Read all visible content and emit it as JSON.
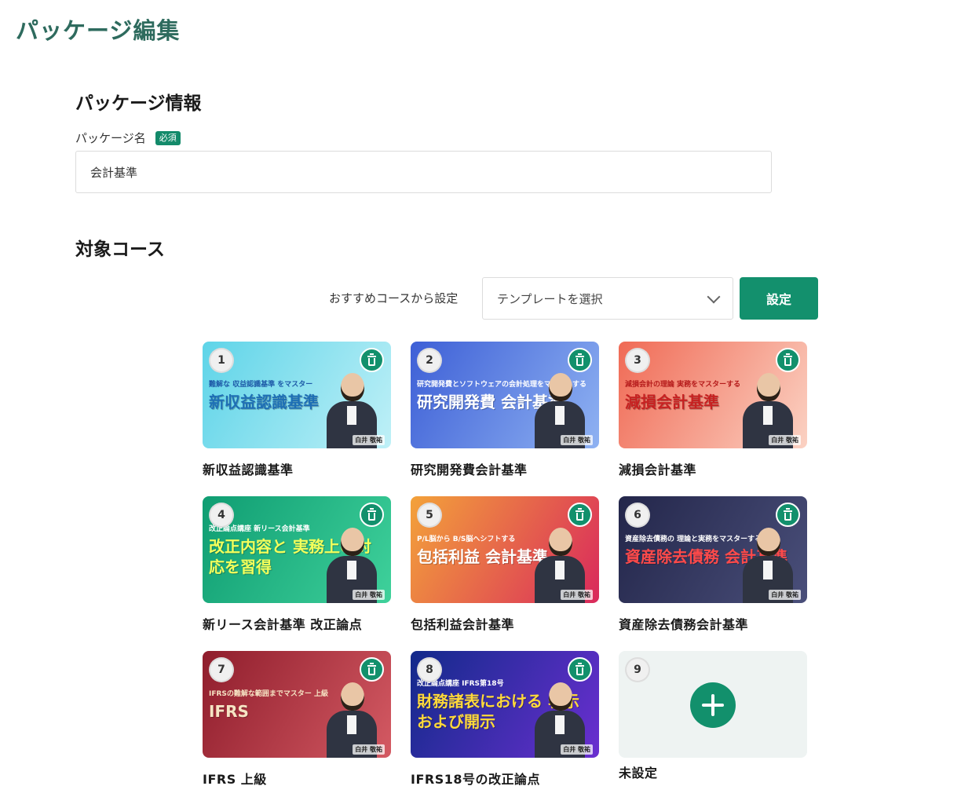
{
  "page": {
    "title": "パッケージ編集"
  },
  "package_info": {
    "section_title": "パッケージ情報",
    "name_label": "パッケージ名",
    "required_badge": "必須",
    "name_value": "会計基準"
  },
  "target_courses": {
    "section_title": "対象コース",
    "template_label": "おすすめコースから設定",
    "template_select": {
      "selected": "テンプレートを選択",
      "icon": "chevron-down-icon"
    },
    "set_button": "設定",
    "courses": [
      {
        "number": "1",
        "title": "新収益認識基準",
        "banner_headline": "新収益認識基準",
        "banner_tag": "難解な 収益認識基準 をマスター",
        "caption": "白井 敬祐",
        "bg_from": "#5ed4e8",
        "bg_to": "#bff0f7",
        "text_color": "#1e6fb5",
        "tag_color": "#1e5aa8"
      },
      {
        "number": "2",
        "title": "研究開発費会計基準",
        "banner_headline": "研究開発費 会計基準",
        "banner_tag": "研究開発費とソフトウェアの会計処理をマスターする",
        "caption": "白井 敬祐",
        "bg_from": "#3d5fd6",
        "bg_to": "#8fb2f2",
        "text_color": "#ffffff",
        "tag_color": "#ffffff"
      },
      {
        "number": "3",
        "title": "減損会計基準",
        "banner_headline": "減損会計基準",
        "banner_tag": "減損会計の理論 実務をマスターする",
        "caption": "白井 敬祐",
        "bg_from": "#f06a55",
        "bg_to": "#fbd2c3",
        "text_color": "#c72121",
        "tag_color": "#b51b1b"
      },
      {
        "number": "4",
        "title": "新リース会計基準 改正論点",
        "banner_headline": "改正内容と 実務上の対応を習得",
        "banner_tag": "改正論点講座 新リース会計基準",
        "caption": "白井 敬祐",
        "bg_from": "#0f9d72",
        "bg_to": "#3fd19b",
        "text_color": "#f3ff5b",
        "tag_color": "#ffffff"
      },
      {
        "number": "5",
        "title": "包括利益会計基準",
        "banner_headline": "包括利益 会計基準",
        "banner_tag": "P/L脳から B/S脳へシフトする",
        "caption": "白井 敬祐",
        "bg_from": "#f3a23a",
        "bg_to": "#d9295c",
        "text_color": "#ffffff",
        "tag_color": "#ffffff"
      },
      {
        "number": "6",
        "title": "資産除去債務会計基準",
        "banner_headline": "資産除去債務 会計基準",
        "banner_tag": "資産除去債務の 理論と実務をマスターする",
        "caption": "白井 敬祐",
        "bg_from": "#23264a",
        "bg_to": "#4a4f7a",
        "text_color": "#ff4a4a",
        "tag_color": "#ffffff"
      },
      {
        "number": "7",
        "title": "IFRS 上級",
        "banner_headline": "IFRS",
        "banner_tag": "IFRSの難解な範囲までマスター 上級",
        "caption": "白井 敬祐",
        "bg_from": "#8f1d2c",
        "bg_to": "#d45a63",
        "text_color": "#f6e4c4",
        "tag_color": "#f6e4c4"
      },
      {
        "number": "8",
        "title": "IFRS18号の改正論点",
        "banner_headline": "財務諸表における 表示および開示",
        "banner_tag": "改正論点講座 IFRS第18号",
        "caption": "白井 敬祐",
        "bg_from": "#122a8a",
        "bg_to": "#6a2fd0",
        "text_color": "#ffd93a",
        "tag_color": "#ffffff"
      }
    ],
    "add_slot": {
      "number": "9",
      "title": "未設定",
      "icon": "plus-icon"
    }
  },
  "colors": {
    "accent": "#13906d",
    "title_green": "#2e6b5e"
  }
}
